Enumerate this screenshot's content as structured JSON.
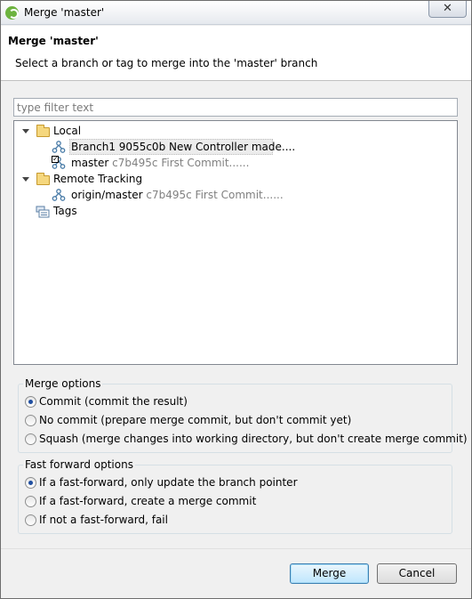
{
  "window": {
    "title": "Merge 'master'",
    "close_glyph": "✕"
  },
  "header": {
    "title": "Merge 'master'",
    "description": "Select a branch or tag to merge into the 'master' branch"
  },
  "filter": {
    "placeholder": "type filter text",
    "value": ""
  },
  "tree": {
    "local": {
      "label": "Local",
      "items": [
        {
          "name": "Branch1",
          "hash": "9055c0b",
          "message": "New Controller made....",
          "selected": true
        },
        {
          "name": "master",
          "hash": "c7b495c",
          "message": "First Commit......",
          "checked_out": true
        }
      ]
    },
    "remote": {
      "label": "Remote Tracking",
      "items": [
        {
          "name": "origin/master",
          "hash": "c7b495c",
          "message": "First Commit......"
        }
      ]
    },
    "tags": {
      "label": "Tags"
    }
  },
  "merge_options": {
    "title": "Merge options",
    "options": [
      {
        "label": "Commit (commit the result)",
        "selected": true
      },
      {
        "label": "No commit (prepare merge commit, but don't commit yet)",
        "selected": false
      },
      {
        "label": "Squash (merge changes into working directory, but don't create merge commit)",
        "selected": false
      }
    ]
  },
  "ff_options": {
    "title": "Fast forward options",
    "options": [
      {
        "label": "If a fast-forward, only update the branch pointer",
        "selected": true
      },
      {
        "label": "If a fast-forward, create a merge commit",
        "selected": false
      },
      {
        "label": "If not a fast-forward, fail",
        "selected": false
      }
    ]
  },
  "buttons": {
    "merge": "Merge",
    "cancel": "Cancel"
  },
  "colors": {
    "accent": "#1f4ea0",
    "default_button": "#3c7fb1",
    "app_icon": "#6db33f"
  }
}
